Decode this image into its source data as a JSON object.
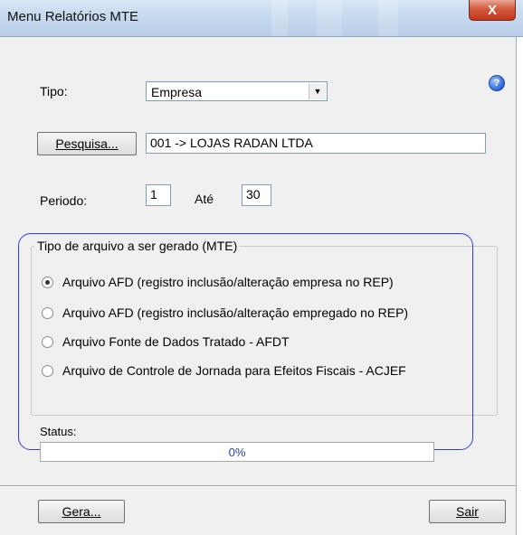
{
  "window": {
    "title": "Menu Relatórios MTE",
    "close_glyph": "X"
  },
  "help": {
    "icon": "help-icon",
    "glyph": "?"
  },
  "tipo": {
    "label": "Tipo:",
    "selected": "Empresa",
    "dropdown_arrow": "▼"
  },
  "pesquisa": {
    "button_label": "Pesquisa...",
    "value": "001 -> LOJAS RADAN LTDA"
  },
  "periodo": {
    "label": "Periodo:",
    "from": "1",
    "to_label": "Até",
    "to": "30"
  },
  "file_type": {
    "title": "Tipo de arquivo a ser gerado (MTE)",
    "options": [
      {
        "label": "Arquivo AFD (registro inclusão/alteração empresa no REP)",
        "checked": true
      },
      {
        "label": "Arquivo AFD (registro inclusão/alteração empregado no REP)",
        "checked": false
      },
      {
        "label": "Arquivo Fonte de Dados Tratado - AFDT",
        "checked": false
      },
      {
        "label": "Arquivo de Controle de Jornada para Efeitos Fiscais - ACJEF",
        "checked": false
      }
    ]
  },
  "status": {
    "label": "Status:",
    "progress_text": "0%",
    "progress": 0
  },
  "footer": {
    "generate_label": "Gera...",
    "exit_label": "Sair"
  },
  "colors": {
    "highlight": "#2f3fd6",
    "close_button": "#c1361b",
    "progress_text": "#2a3fa0"
  }
}
